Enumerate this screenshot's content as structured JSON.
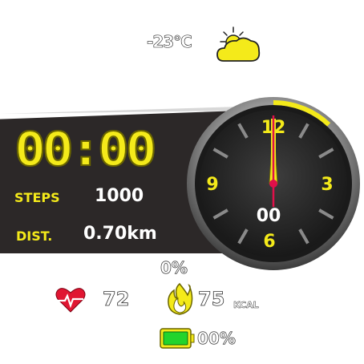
{
  "weather": {
    "temperature": "-23°C",
    "icon": "partly-cloudy-icon"
  },
  "clock": {
    "time": "00:00"
  },
  "stats": {
    "steps_label": "STEPS",
    "steps_value": "1000",
    "distance_label": "DIST.",
    "distance_value": "0.70km"
  },
  "gauge": {
    "numerals": [
      "12",
      "3",
      "6",
      "9"
    ],
    "seconds": "00",
    "arc_fill": 0.12,
    "accent_color": "#f4ea1a"
  },
  "progress": {
    "percent": "0%"
  },
  "heart_rate": {
    "value": "72",
    "icon": "heart-rate-icon"
  },
  "calories": {
    "value": "75",
    "unit": "KCAL",
    "icon": "flame-icon"
  },
  "battery": {
    "value": "00%",
    "icon": "battery-icon"
  }
}
